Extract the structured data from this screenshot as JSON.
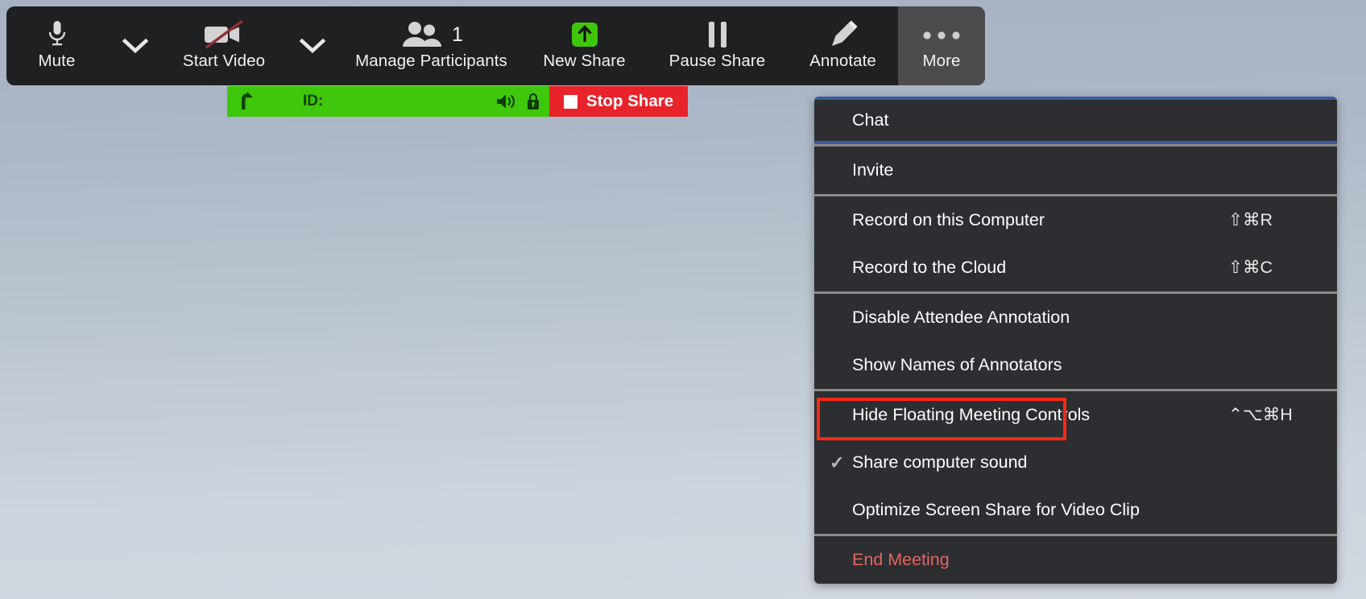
{
  "theme": {
    "toolbar_bg": "#1f2021",
    "toolbar_highlight": "#4b4c4e",
    "menu_bg": "#2c2e31",
    "menu_separator": "#8b8b8b",
    "focus_blue": "#3b5a9e",
    "share_green": "#3ec70b",
    "stop_red": "#e8232a",
    "danger_text": "#e4655c",
    "annotation_red": "#f42a14",
    "desktop_top": "#a7b3c3",
    "desktop_bottom": "#d2d8e0"
  },
  "toolbar": {
    "buttons": [
      {
        "label": "Mute",
        "icon": "microphone-icon",
        "state": "unmuted"
      },
      {
        "label": "",
        "icon": "chevron-down-icon",
        "state": "audio-options"
      },
      {
        "label": "Start Video",
        "icon": "video-camera-off-icon",
        "state": "video-stopped"
      },
      {
        "label": "",
        "icon": "chevron-down-icon",
        "state": "video-options"
      },
      {
        "label": "Manage Participants",
        "icon": "participants-icon",
        "badge": "1"
      },
      {
        "label": "New Share",
        "icon": "share-up-arrow-icon",
        "state": "green"
      },
      {
        "label": "Pause Share",
        "icon": "pause-icon",
        "state": "sharing"
      },
      {
        "label": "Annotate",
        "icon": "pencil-icon",
        "state": "idle"
      },
      {
        "label": "More",
        "icon": "ellipsis-icon",
        "state": "active"
      }
    ]
  },
  "share_bar": {
    "up_icon": "share-arrow-icon",
    "id_label": "ID:",
    "speaker_icon": "speaker-sound-icon",
    "lock_icon": "lock-closed-icon",
    "stop_button_label": "Stop Share",
    "stop_icon": "stop-square-icon"
  },
  "more_menu": {
    "groups": [
      {
        "items": [
          {
            "label": "Chat",
            "shortcut": "",
            "focused": true,
            "checked": false,
            "danger": false
          }
        ]
      },
      {
        "items": [
          {
            "label": "Invite",
            "shortcut": "",
            "focused": false,
            "checked": false,
            "danger": false
          }
        ]
      },
      {
        "items": [
          {
            "label": "Record on this Computer",
            "shortcut": "⇧⌘R",
            "focused": false,
            "checked": false,
            "danger": false
          },
          {
            "label": "Record to the Cloud",
            "shortcut": "⇧⌘C",
            "focused": false,
            "checked": false,
            "danger": false
          }
        ]
      },
      {
        "items": [
          {
            "label": "Disable Attendee Annotation",
            "shortcut": "",
            "focused": false,
            "checked": false,
            "danger": false
          },
          {
            "label": "Show Names of Annotators",
            "shortcut": "",
            "focused": false,
            "checked": false,
            "danger": false
          }
        ]
      },
      {
        "items": [
          {
            "label": "Hide Floating Meeting Controls",
            "shortcut": "⌃⌥⌘H",
            "focused": false,
            "checked": false,
            "danger": false
          },
          {
            "label": "Share computer sound",
            "shortcut": "",
            "focused": false,
            "checked": true,
            "danger": false
          },
          {
            "label": "Optimize Screen Share for Video Clip",
            "shortcut": "",
            "focused": false,
            "checked": false,
            "danger": false
          }
        ]
      },
      {
        "items": [
          {
            "label": "End Meeting",
            "shortcut": "",
            "focused": false,
            "checked": false,
            "danger": true
          }
        ]
      }
    ],
    "check_glyph": "✓"
  },
  "annotation": {
    "target_label": "Share computer sound",
    "shape": "rectangle",
    "color": "#f42a14"
  }
}
